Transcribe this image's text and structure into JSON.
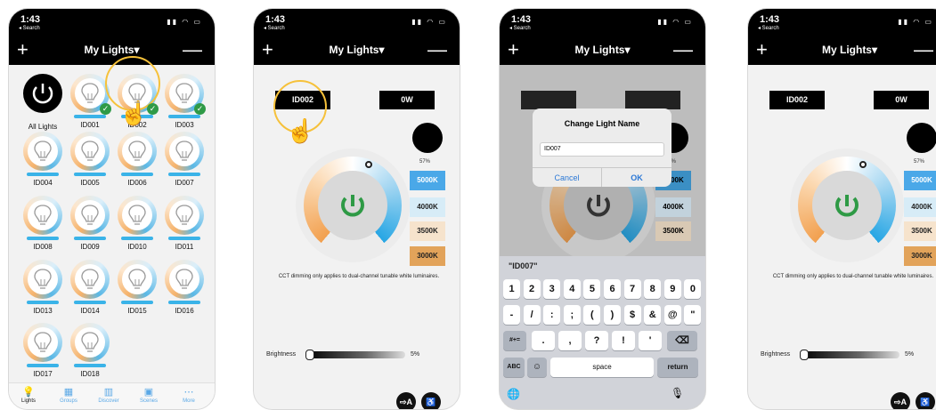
{
  "status": {
    "time": "1:43",
    "back": "◂ Search"
  },
  "nav": {
    "title": "My Lights▾",
    "plus": "+",
    "minus": "—"
  },
  "grid": {
    "all_lights_label": "All Lights",
    "lights": [
      "ID001",
      "ID002",
      "ID003",
      "ID004",
      "ID005",
      "ID006",
      "ID007",
      "ID008",
      "ID009",
      "ID010",
      "ID011",
      "ID013",
      "ID014",
      "ID015",
      "ID016",
      "ID017",
      "ID018"
    ]
  },
  "tabs": [
    {
      "icon": "bulb-icon",
      "label": "Lights"
    },
    {
      "icon": "groups-icon",
      "label": "Groups"
    },
    {
      "icon": "discover-icon",
      "label": "Discover"
    },
    {
      "icon": "scenes-icon",
      "label": "Scenes"
    },
    {
      "icon": "more-icon",
      "label": "More"
    }
  ],
  "detail": {
    "name": "ID002",
    "power": "0W",
    "percent": "57%",
    "cct_options": [
      "5000K",
      "4000K",
      "3500K",
      "3000K"
    ],
    "cct_colors": [
      "#4aa8e8",
      "#d7ecf7",
      "#f6e3cc",
      "#e2a35a"
    ],
    "note": "CCT dimming only applies to dual-channel tunable white luminaires.",
    "brightness_label": "Brightness",
    "brightness_value": "5%"
  },
  "dialog": {
    "title": "Change Light Name",
    "value": "ID007",
    "cancel": "Cancel",
    "ok": "OK"
  },
  "keyboard": {
    "suggestion": "\"ID007\"",
    "row1": [
      "1",
      "2",
      "3",
      "4",
      "5",
      "6",
      "7",
      "8",
      "9",
      "0"
    ],
    "row2": [
      "-",
      "/",
      ":",
      ";",
      "(",
      ")",
      "$",
      "&",
      "@",
      "\""
    ],
    "row3": [
      ".",
      ",",
      "?",
      "!",
      "'"
    ],
    "sym": "#+=",
    "abc": "ABC",
    "space": "space",
    "return": "return"
  }
}
